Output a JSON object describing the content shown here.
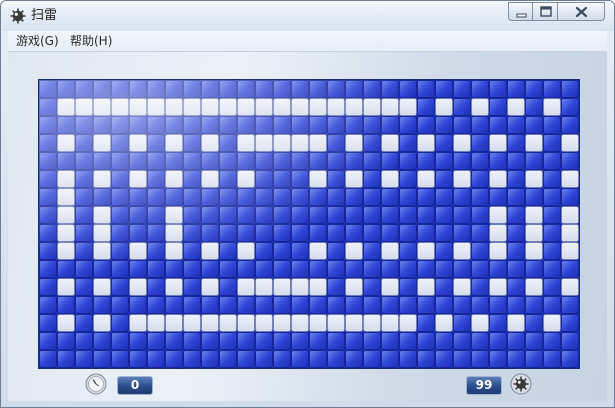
{
  "window": {
    "title": "扫雷",
    "app_icon": "mine-icon"
  },
  "caption_buttons": {
    "minimize": "minimize-icon",
    "maximize": "maximize-icon",
    "close": "close-icon"
  },
  "menu": {
    "items": [
      {
        "label": "游戏(G)"
      },
      {
        "label": "帮助(H)"
      }
    ]
  },
  "game": {
    "columns": 30,
    "rows": 16,
    "revealed_pattern": [
      "000000000000000000000000000000",
      "011111111111111111111010101010",
      "000000000000000000000000000000",
      "010101010101111101010101010101",
      "000000000000000000000000000000",
      "010101010101000101010101010101",
      "010000000000000000000000000000",
      "010100010000000000000000010101",
      "010100010000000000000000010101",
      "010101010101000101010101010101",
      "000000000000000000000000000000",
      "010101010101111101010101010101",
      "000000000000000000000000000000",
      "010101111111111111111010101010",
      "000000000000000000000000000000",
      "000000000000000000000000000000"
    ],
    "hidden_color": "#2f45d6",
    "revealed_color": "#d6dcec"
  },
  "status": {
    "timer_value": "0",
    "timer_icon": "timer-icon",
    "mines_value": "99",
    "mines_icon": "mine-icon"
  }
}
